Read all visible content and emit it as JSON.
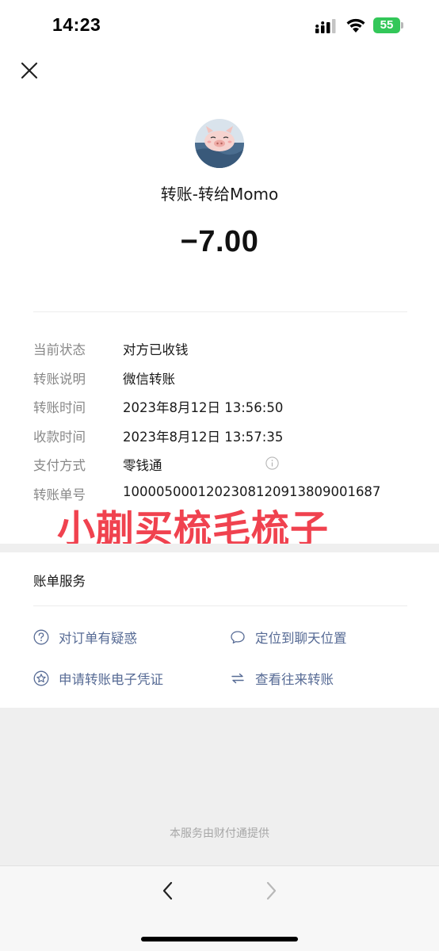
{
  "status_bar": {
    "time": "14:23",
    "battery": "55",
    "icons": [
      "signal-icon",
      "wifi-icon",
      "battery-icon"
    ]
  },
  "header": {
    "close_icon": "close-icon"
  },
  "transfer": {
    "title": "转账-转给Momo",
    "amount": "−7.00"
  },
  "details": [
    {
      "label": "当前状态",
      "value": "对方已收钱"
    },
    {
      "label": "转账说明",
      "value": "微信转账"
    },
    {
      "label": "转账时间",
      "value": "2023年8月12日 13:56:50"
    },
    {
      "label": "收款时间",
      "value": "2023年8月12日 13:57:35"
    },
    {
      "label": "支付方式",
      "value": "零钱通"
    },
    {
      "label": "转账单号",
      "value": "10000500012023081209138090016​87"
    }
  ],
  "watermark": "小蒯买梳毛梳子",
  "services": {
    "title": "账单服务",
    "items": [
      {
        "label": "对订单有疑惑",
        "icon": "question-circle-icon"
      },
      {
        "label": "定位到聊天位置",
        "icon": "chat-bubble-icon"
      },
      {
        "label": "申请转账电子凭证",
        "icon": "star-badge-icon"
      },
      {
        "label": "查看往来转账",
        "icon": "exchange-arrows-icon"
      }
    ]
  },
  "footer": {
    "text": "本服务由财付通提供"
  },
  "colors": {
    "link": "#576b95",
    "watermark": "#f0424f",
    "battery": "#33c759"
  }
}
